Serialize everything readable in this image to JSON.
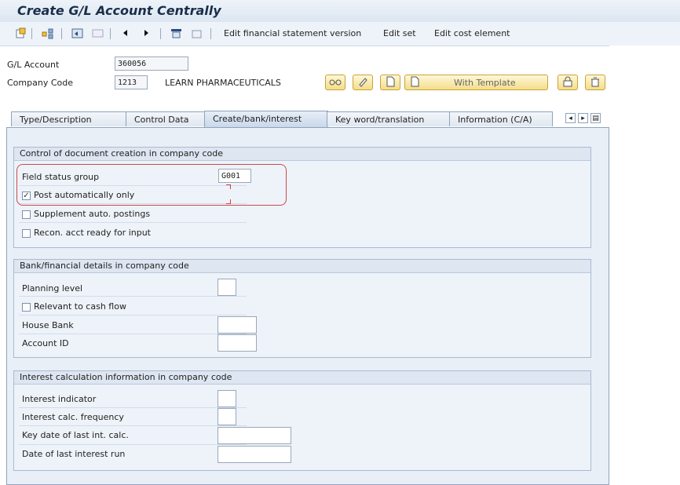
{
  "window": {
    "title": "Create G/L Account Centrally"
  },
  "toolbar": {
    "icons": [
      "new-document-icon",
      "hierarchy-icon",
      "undo-icon",
      "redo-icon",
      "back-arrow-icon",
      "forward-arrow-icon",
      "layout-icon",
      "folder-icon"
    ],
    "menu_edit_fs_version": "Edit financial statement version",
    "menu_edit_set": "Edit set",
    "menu_edit_cost_element": "Edit cost element"
  },
  "header": {
    "gl_account_label": "G/L Account",
    "gl_account_value": "360056",
    "company_code_label": "Company Code",
    "company_code_value": "1213",
    "company_name": "LEARN PHARMACEUTICALS",
    "with_template_label": "With Template"
  },
  "tabs": [
    {
      "label": "Type/Description"
    },
    {
      "label": "Control Data"
    },
    {
      "label": "Create/bank/interest",
      "active": true
    },
    {
      "label": "Key word/translation"
    },
    {
      "label": "Information (C/A)"
    }
  ],
  "group_doc": {
    "title": "Control of document creation in company code",
    "field_status_label": "Field status group",
    "field_status_value": "G001",
    "post_auto_label": "Post automatically only",
    "post_auto_checked": true,
    "supplement_label": "Supplement auto. postings",
    "recon_label": "Recon. acct ready for input"
  },
  "group_bank": {
    "title": "Bank/financial details in company code",
    "planning_level_label": "Planning level",
    "relevant_cash_label": "Relevant to cash flow",
    "house_bank_label": "House Bank",
    "account_id_label": "Account ID"
  },
  "group_interest": {
    "title": "Interest calculation information in company code",
    "interest_indicator_label": "Interest indicator",
    "interest_freq_label": "Interest calc. frequency",
    "key_date_label": "Key date of last int. calc.",
    "date_last_run_label": "Date of last interest run"
  },
  "colors": {
    "highlight": "#c94a4a",
    "panel_bg": "#e9eff6",
    "button_bg": "#f3dd8a"
  }
}
